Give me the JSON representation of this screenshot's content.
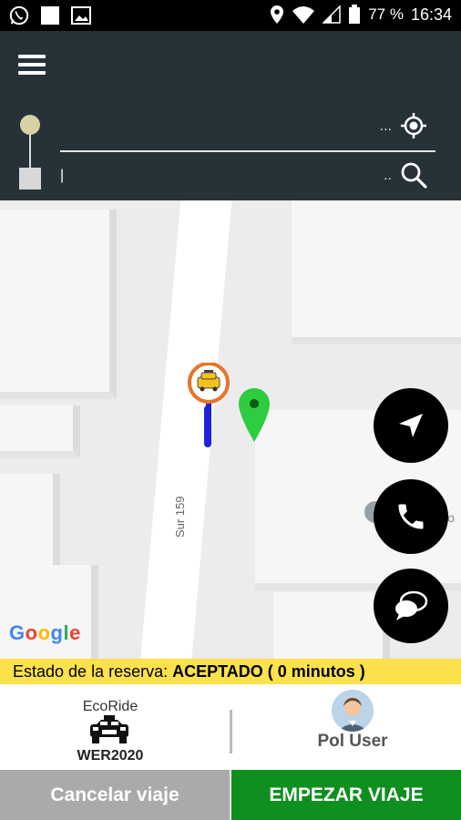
{
  "status_bar": {
    "battery_percent": "77 %",
    "time": "16:34",
    "icons": [
      "whatsapp-icon",
      "square-icon",
      "image-icon",
      "location-icon",
      "wifi-icon",
      "signal-icon",
      "battery-icon"
    ]
  },
  "search": {
    "pickup_dots": "...",
    "drop_value": "|",
    "drop_dots": "..",
    "pickup_icon": "my-location-icon",
    "drop_icon": "search-icon"
  },
  "map": {
    "street_label": "Sur 159",
    "poi_label_partial": "lo",
    "google_logo": "Google",
    "fab_icons": [
      "navigation-icon",
      "phone-icon",
      "chat-icon"
    ]
  },
  "booking": {
    "status_prefix": "Estado de la reserva:",
    "status_value": "ACEPTADO ( 0 minutos )"
  },
  "driver": {
    "brand": "EcoRide",
    "plate": "WER2020"
  },
  "user": {
    "name": "Pol User"
  },
  "actions": {
    "cancel_label": "Cancelar viaje",
    "start_label": "EMPEZAR VIAJE"
  },
  "colors": {
    "topbar": "#263238",
    "status_strip": "#fbe14c",
    "start_button": "#0f8f1f",
    "cancel_button": "#aaaaaa",
    "dest_pin": "#2ecc40",
    "taxi_pin": "#e8742a",
    "route_line": "#1e22d8"
  }
}
